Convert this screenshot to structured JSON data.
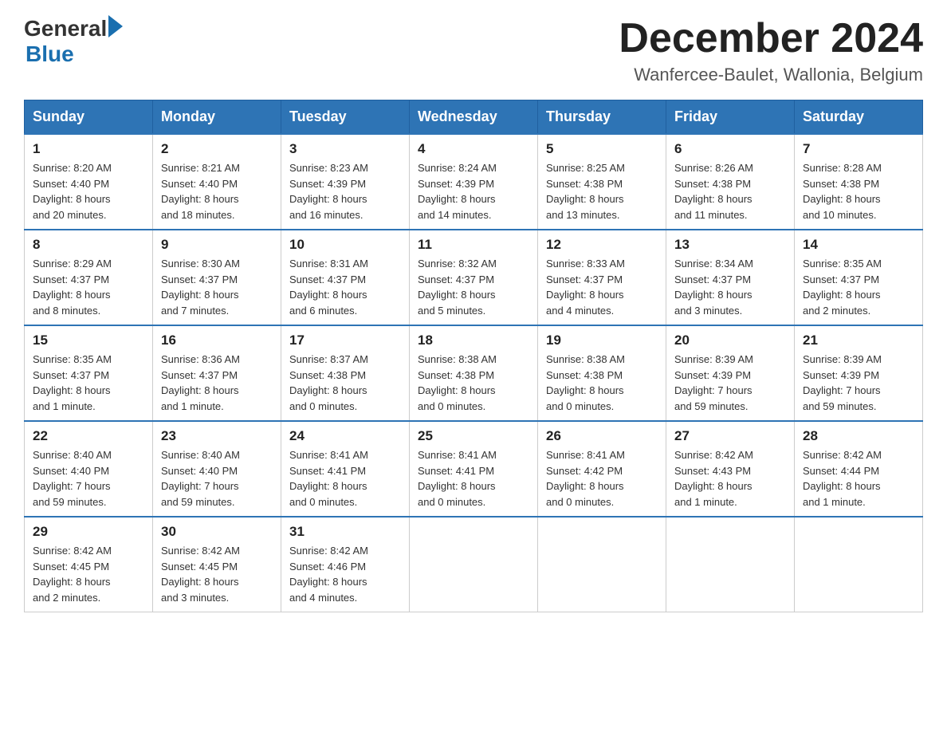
{
  "header": {
    "logo": {
      "general": "General",
      "blue": "Blue"
    },
    "title": "December 2024",
    "location": "Wanfercee-Baulet, Wallonia, Belgium"
  },
  "days_of_week": [
    "Sunday",
    "Monday",
    "Tuesday",
    "Wednesday",
    "Thursday",
    "Friday",
    "Saturday"
  ],
  "weeks": [
    [
      {
        "day": "1",
        "info": "Sunrise: 8:20 AM\nSunset: 4:40 PM\nDaylight: 8 hours\nand 20 minutes."
      },
      {
        "day": "2",
        "info": "Sunrise: 8:21 AM\nSunset: 4:40 PM\nDaylight: 8 hours\nand 18 minutes."
      },
      {
        "day": "3",
        "info": "Sunrise: 8:23 AM\nSunset: 4:39 PM\nDaylight: 8 hours\nand 16 minutes."
      },
      {
        "day": "4",
        "info": "Sunrise: 8:24 AM\nSunset: 4:39 PM\nDaylight: 8 hours\nand 14 minutes."
      },
      {
        "day": "5",
        "info": "Sunrise: 8:25 AM\nSunset: 4:38 PM\nDaylight: 8 hours\nand 13 minutes."
      },
      {
        "day": "6",
        "info": "Sunrise: 8:26 AM\nSunset: 4:38 PM\nDaylight: 8 hours\nand 11 minutes."
      },
      {
        "day": "7",
        "info": "Sunrise: 8:28 AM\nSunset: 4:38 PM\nDaylight: 8 hours\nand 10 minutes."
      }
    ],
    [
      {
        "day": "8",
        "info": "Sunrise: 8:29 AM\nSunset: 4:37 PM\nDaylight: 8 hours\nand 8 minutes."
      },
      {
        "day": "9",
        "info": "Sunrise: 8:30 AM\nSunset: 4:37 PM\nDaylight: 8 hours\nand 7 minutes."
      },
      {
        "day": "10",
        "info": "Sunrise: 8:31 AM\nSunset: 4:37 PM\nDaylight: 8 hours\nand 6 minutes."
      },
      {
        "day": "11",
        "info": "Sunrise: 8:32 AM\nSunset: 4:37 PM\nDaylight: 8 hours\nand 5 minutes."
      },
      {
        "day": "12",
        "info": "Sunrise: 8:33 AM\nSunset: 4:37 PM\nDaylight: 8 hours\nand 4 minutes."
      },
      {
        "day": "13",
        "info": "Sunrise: 8:34 AM\nSunset: 4:37 PM\nDaylight: 8 hours\nand 3 minutes."
      },
      {
        "day": "14",
        "info": "Sunrise: 8:35 AM\nSunset: 4:37 PM\nDaylight: 8 hours\nand 2 minutes."
      }
    ],
    [
      {
        "day": "15",
        "info": "Sunrise: 8:35 AM\nSunset: 4:37 PM\nDaylight: 8 hours\nand 1 minute."
      },
      {
        "day": "16",
        "info": "Sunrise: 8:36 AM\nSunset: 4:37 PM\nDaylight: 8 hours\nand 1 minute."
      },
      {
        "day": "17",
        "info": "Sunrise: 8:37 AM\nSunset: 4:38 PM\nDaylight: 8 hours\nand 0 minutes."
      },
      {
        "day": "18",
        "info": "Sunrise: 8:38 AM\nSunset: 4:38 PM\nDaylight: 8 hours\nand 0 minutes."
      },
      {
        "day": "19",
        "info": "Sunrise: 8:38 AM\nSunset: 4:38 PM\nDaylight: 8 hours\nand 0 minutes."
      },
      {
        "day": "20",
        "info": "Sunrise: 8:39 AM\nSunset: 4:39 PM\nDaylight: 7 hours\nand 59 minutes."
      },
      {
        "day": "21",
        "info": "Sunrise: 8:39 AM\nSunset: 4:39 PM\nDaylight: 7 hours\nand 59 minutes."
      }
    ],
    [
      {
        "day": "22",
        "info": "Sunrise: 8:40 AM\nSunset: 4:40 PM\nDaylight: 7 hours\nand 59 minutes."
      },
      {
        "day": "23",
        "info": "Sunrise: 8:40 AM\nSunset: 4:40 PM\nDaylight: 7 hours\nand 59 minutes."
      },
      {
        "day": "24",
        "info": "Sunrise: 8:41 AM\nSunset: 4:41 PM\nDaylight: 8 hours\nand 0 minutes."
      },
      {
        "day": "25",
        "info": "Sunrise: 8:41 AM\nSunset: 4:41 PM\nDaylight: 8 hours\nand 0 minutes."
      },
      {
        "day": "26",
        "info": "Sunrise: 8:41 AM\nSunset: 4:42 PM\nDaylight: 8 hours\nand 0 minutes."
      },
      {
        "day": "27",
        "info": "Sunrise: 8:42 AM\nSunset: 4:43 PM\nDaylight: 8 hours\nand 1 minute."
      },
      {
        "day": "28",
        "info": "Sunrise: 8:42 AM\nSunset: 4:44 PM\nDaylight: 8 hours\nand 1 minute."
      }
    ],
    [
      {
        "day": "29",
        "info": "Sunrise: 8:42 AM\nSunset: 4:45 PM\nDaylight: 8 hours\nand 2 minutes."
      },
      {
        "day": "30",
        "info": "Sunrise: 8:42 AM\nSunset: 4:45 PM\nDaylight: 8 hours\nand 3 minutes."
      },
      {
        "day": "31",
        "info": "Sunrise: 8:42 AM\nSunset: 4:46 PM\nDaylight: 8 hours\nand 4 minutes."
      },
      null,
      null,
      null,
      null
    ]
  ]
}
